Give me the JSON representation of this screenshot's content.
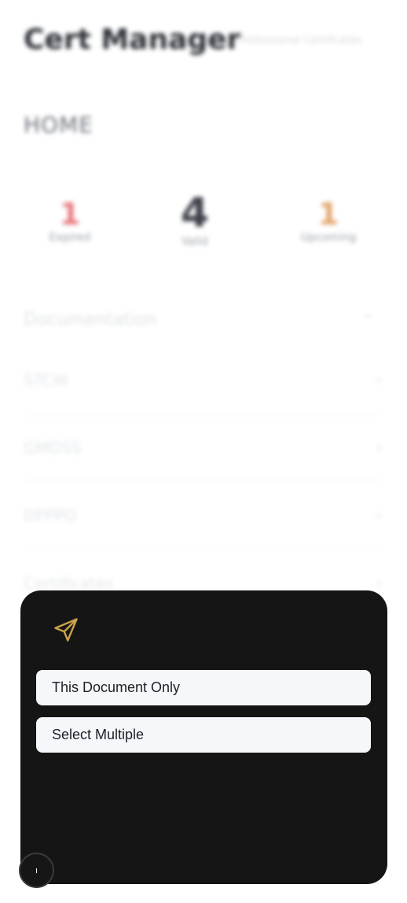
{
  "app": {
    "title": "Cert Manager",
    "subtitle": "Professional Certificates"
  },
  "section": {
    "title": "HOME"
  },
  "stats": {
    "expired": {
      "value": "1",
      "label": "Expired"
    },
    "valid": {
      "value": "4",
      "label": "Valid"
    },
    "upcoming": {
      "value": "1",
      "label": "Upcoming"
    }
  },
  "documentation": {
    "label": "Documentation",
    "chevron": "⌃"
  },
  "rows": [
    {
      "label": "STCW",
      "chevron": "›"
    },
    {
      "label": "GMDSS",
      "chevron": "›"
    },
    {
      "label": "DPPPO",
      "chevron": "›"
    },
    {
      "label": "Certificates",
      "chevron": "›"
    }
  ],
  "sheet": {
    "icon": "send-icon",
    "icon_color": "#c9a24a",
    "options": [
      {
        "label": "This Document Only"
      },
      {
        "label": "Select Multiple"
      }
    ]
  },
  "fab": {
    "label": "ı"
  }
}
